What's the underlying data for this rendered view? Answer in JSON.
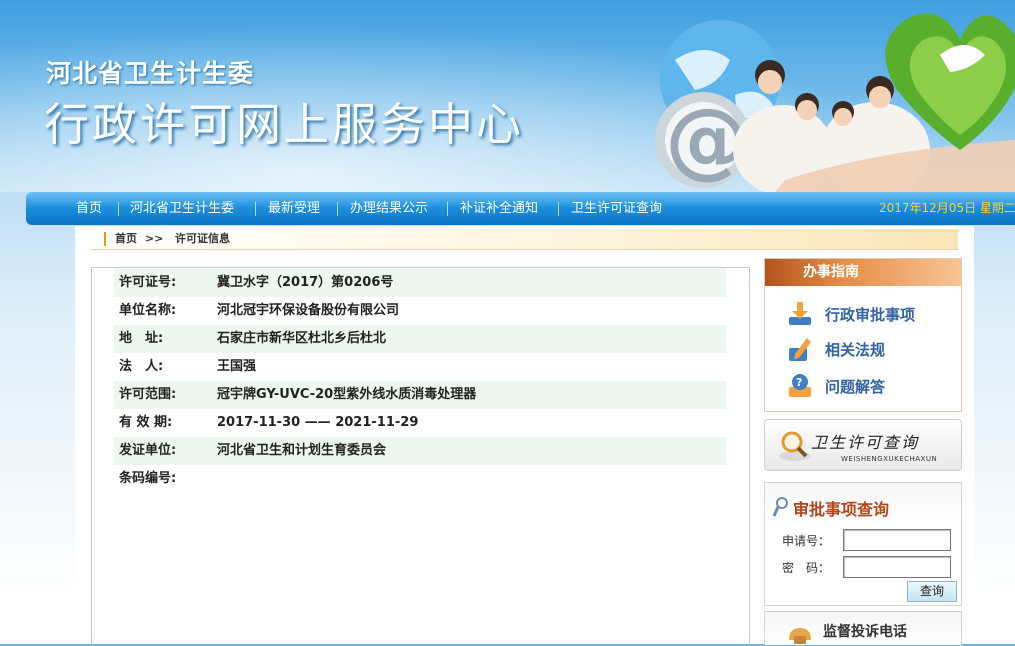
{
  "header": {
    "org_name": "河北省卫生计生委",
    "site_title": "行政许可网上服务中心"
  },
  "nav": {
    "items": [
      {
        "label": "首页"
      },
      {
        "label": "河北省卫生计生委"
      },
      {
        "label": "最新受理"
      },
      {
        "label": "办理结果公示"
      },
      {
        "label": "补证补全通知"
      },
      {
        "label": "卫生许可证查询"
      }
    ],
    "date": "2017年12月05日 星期二"
  },
  "breadcrumb": {
    "home": "首页",
    "sep": ">>",
    "current": "许可证信息"
  },
  "permit": {
    "rows": [
      {
        "label": "许可证号:",
        "value": "冀卫水字（2017）第0206号"
      },
      {
        "label": "单位名称:",
        "value": "河北冠宇环保设备股份有限公司"
      },
      {
        "label": "地　址:",
        "value": "石家庄市新华区杜北乡后杜北"
      },
      {
        "label": "法　人:",
        "value": "王国强"
      },
      {
        "label": "许可范围:",
        "value": "冠宇牌GY-UVC-20型紫外线水质消毒处理器"
      },
      {
        "label": "有 效 期:",
        "value": "2017-11-30 —— 2021-11-29"
      },
      {
        "label": "发证单位:",
        "value": "河北省卫生和计划生育委员会"
      },
      {
        "label": "条码编号:",
        "value": ""
      }
    ]
  },
  "guide": {
    "title": "办事指南",
    "items": [
      {
        "label": "行政审批事项",
        "icon": "download-arrow-icon"
      },
      {
        "label": "相关法规",
        "icon": "edit-pen-icon"
      },
      {
        "label": "问题解答",
        "icon": "question-icon"
      }
    ]
  },
  "license_query": {
    "title": "卫生许可查询",
    "subtitle": "WEISHENGXUKECHAXUN"
  },
  "approval_query": {
    "title": "审批事项查询",
    "app_no_label": "申请号：",
    "app_no_value": "",
    "password_label": "密　码：",
    "password_value": "",
    "button": "查询"
  },
  "complaint": {
    "title": "监督投诉电话"
  },
  "colors": {
    "nav_blue": "#1b8ddc",
    "date_yellow": "#f4d43a",
    "guide_orange": "#e78d48",
    "link_blue": "#3561a7"
  }
}
